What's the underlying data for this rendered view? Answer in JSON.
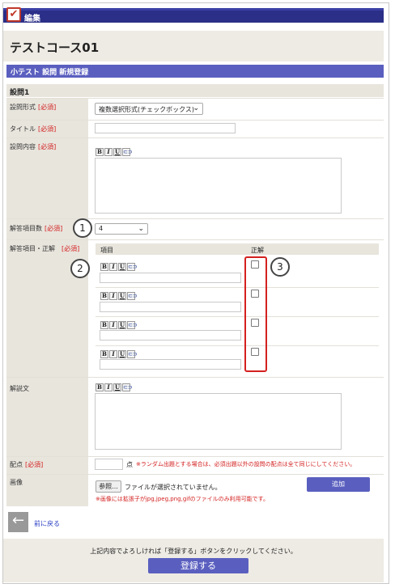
{
  "header": {
    "title": "編集"
  },
  "course_title": "テストコース01",
  "section_title": "小テスト 設問 新規登録",
  "question_heading": "設問1",
  "required_tag": "[必須]",
  "fields": {
    "question_type": {
      "label": "設問形式",
      "value": "複数選択形式(チェックボックス)"
    },
    "title": {
      "label": "タイトル",
      "value": ""
    },
    "content": {
      "label": "設問内容"
    },
    "answer_count": {
      "label": "解答項目数",
      "value": "4"
    },
    "answers": {
      "label": "解答項目・正解",
      "col_item": "項目",
      "col_correct": "正解"
    },
    "explanation": {
      "label": "解説文"
    },
    "points": {
      "label": "配点",
      "unit": "点",
      "note": "※ランダム出題とする場合は、必須出題以外の設問の配点は全て同じにしてください。"
    },
    "image": {
      "label": "画像",
      "browse": "参照...",
      "no_file": "ファイルが選択されていません。",
      "note": "※画像には拡張子がjpg,jpeg,png,gifのファイルのみ利用可能です。",
      "add": "追加"
    }
  },
  "toolbar": {
    "bold": "B",
    "italic": "I",
    "underline": "U",
    "link": "⊂⊃"
  },
  "badges": {
    "b1": "1",
    "b2": "2",
    "b3": "3"
  },
  "nav": {
    "back_label": "前に戻る",
    "back_icon": "←"
  },
  "footer": {
    "message": "上記内容でよろしければ「登録する」ボタンをクリックしてください。",
    "submit": "登録する"
  },
  "icons": {
    "check": "✔",
    "chevron": "⌄"
  }
}
